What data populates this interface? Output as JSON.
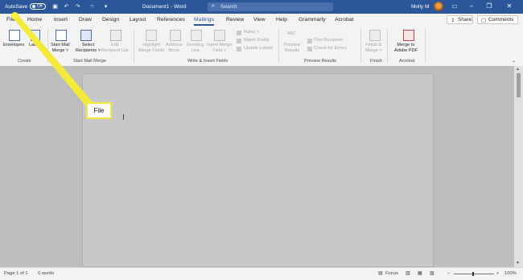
{
  "titlebar": {
    "autosave_label": "AutoSave",
    "autosave_state": "Off",
    "document_title": "Document1 - Word",
    "search_placeholder": "Search",
    "user_name": "Molly M"
  },
  "tabs": [
    "File",
    "Home",
    "Insert",
    "Draw",
    "Design",
    "Layout",
    "References",
    "Mailings",
    "Review",
    "View",
    "Help",
    "Grammarly",
    "Acrobat"
  ],
  "active_tab": "Mailings",
  "share_label": "Share",
  "comments_label": "Comments",
  "ribbon": {
    "create": {
      "envelopes": "Envelopes",
      "labels": "Labels",
      "group_label": "Create"
    },
    "start_mail_merge": {
      "start_line1": "Start Mail",
      "start_line2": "Merge ˅",
      "select_line1": "Select",
      "select_line2": "Recipients ˅",
      "edit_line1": "Edit",
      "edit_line2": "Recipient List",
      "group_label": "Start Mail Merge"
    },
    "write_insert": {
      "highlight_line1": "Highlight",
      "highlight_line2": "Merge Fields",
      "address_line1": "Address",
      "address_line2": "Block",
      "greeting_line1": "Greeting",
      "greeting_line2": "Line",
      "insert_line1": "Insert Merge",
      "insert_line2": "Field ˅",
      "rules": "Rules ˅",
      "match_fields": "Match Fields",
      "update_labels": "Update Labels",
      "group_label": "Write & Insert Fields"
    },
    "preview_results": {
      "abc": "ABC",
      "preview_line1": "Preview",
      "preview_line2": "Results",
      "find_recipient": "Find Recipient",
      "check_errors": "Check for Errors",
      "group_label": "Preview Results"
    },
    "finish": {
      "finish_line1": "Finish &",
      "finish_line2": "Merge ˅",
      "group_label": "Finish"
    },
    "acrobat": {
      "merge_line1": "Merge to",
      "merge_line2": "Adobe PDF",
      "group_label": "Acrobat"
    }
  },
  "callout_label": "File",
  "status": {
    "page": "Page 1 of 1",
    "words": "0 words",
    "focus": "Focus",
    "zoom_percent": "100%"
  }
}
